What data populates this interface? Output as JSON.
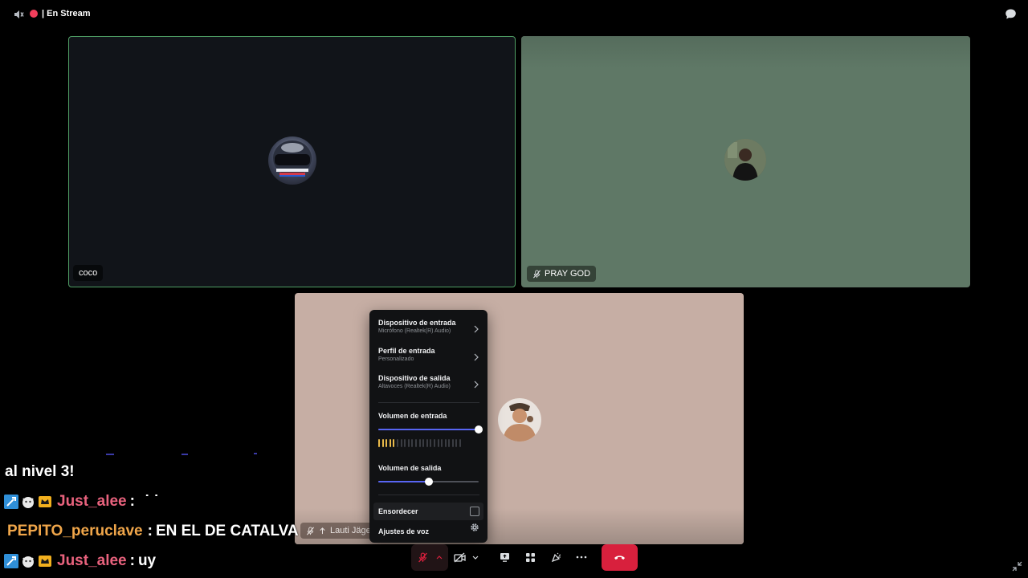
{
  "topbar": {
    "stream_status": "| En Stream",
    "icons": [
      "speaker-icon",
      "live-dot",
      "chat-bubble-icon"
    ]
  },
  "tiles": [
    {
      "name": "coco",
      "speaking": true
    },
    {
      "name": "PRAY GOD",
      "muted": true
    },
    {
      "name": "Lauti Jäger",
      "muted": true
    }
  ],
  "voice_menu": {
    "input_device": {
      "label": "Dispositivo de entrada",
      "value": "Micrófono (Realtek(R) Audio)"
    },
    "input_profile": {
      "label": "Perfil de entrada",
      "value": "Personalizado"
    },
    "output_device": {
      "label": "Dispositivo de salida",
      "value": "Altavoces (Realtek(R) Audio)"
    },
    "input_volume": {
      "label": "Volumen de entrada",
      "level": 1.0
    },
    "input_meter": {
      "active_bars": 5,
      "total_bars": 23
    },
    "output_volume": {
      "label": "Volumen de salida",
      "level": 0.5
    },
    "deafen": {
      "label": "Ensordecer",
      "checked": false
    },
    "voice_settings": {
      "label": "Ajustes de voz"
    }
  },
  "chat": {
    "messages": [
      {
        "user": "",
        "text": "al nivel 3!"
      },
      {
        "user": "Just_alee",
        "sep": ":",
        "text": "˙ ˙",
        "badges": [
          "tool-badge",
          "cat-badge",
          "crown-badge"
        ],
        "color": "#e8627d"
      },
      {
        "user": "PEPITO_peruclave",
        "sep": ":",
        "text": "EN EL DE CATALVA",
        "badges": [],
        "color": "#f0a64a"
      },
      {
        "user": "Just_alee",
        "sep": ":",
        "text": "uy",
        "badges": [
          "tool-badge",
          "cat-badge",
          "crown-badge"
        ],
        "color": "#e8627d"
      }
    ]
  },
  "colors": {
    "accent": "#5865f2",
    "speaking_border": "#4f9e64",
    "hangup": "#d8203d",
    "meter_active": "#e8b94a"
  }
}
